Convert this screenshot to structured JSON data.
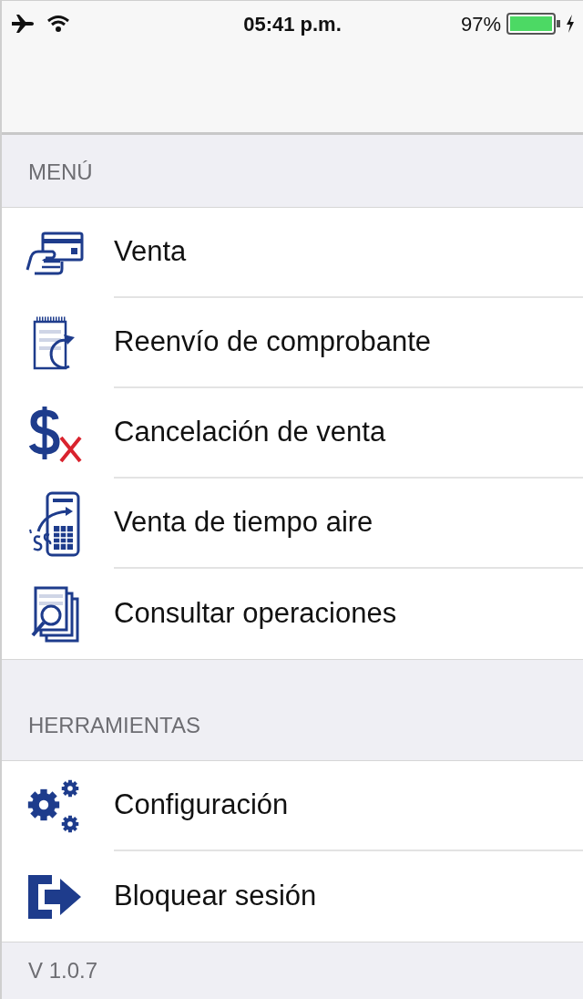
{
  "status_bar": {
    "time": "05:41 p.m.",
    "battery_percent": "97%"
  },
  "sections": [
    {
      "title": "MENÚ",
      "items": [
        {
          "label": "Venta",
          "kind": "card"
        },
        {
          "label": "Reenvío de comprobante",
          "kind": "receipt"
        },
        {
          "label": "Cancelación de venta",
          "kind": "cancel"
        },
        {
          "label": "Venta de tiempo aire",
          "kind": "airtime"
        },
        {
          "label": "Consultar operaciones",
          "kind": "lookup"
        }
      ]
    },
    {
      "title": "HERRAMIENTAS",
      "items": [
        {
          "label": "Configuración",
          "kind": "settings"
        },
        {
          "label": "Bloquear sesión",
          "kind": "logout"
        }
      ]
    }
  ],
  "footer": {
    "version": "V 1.0.7"
  }
}
